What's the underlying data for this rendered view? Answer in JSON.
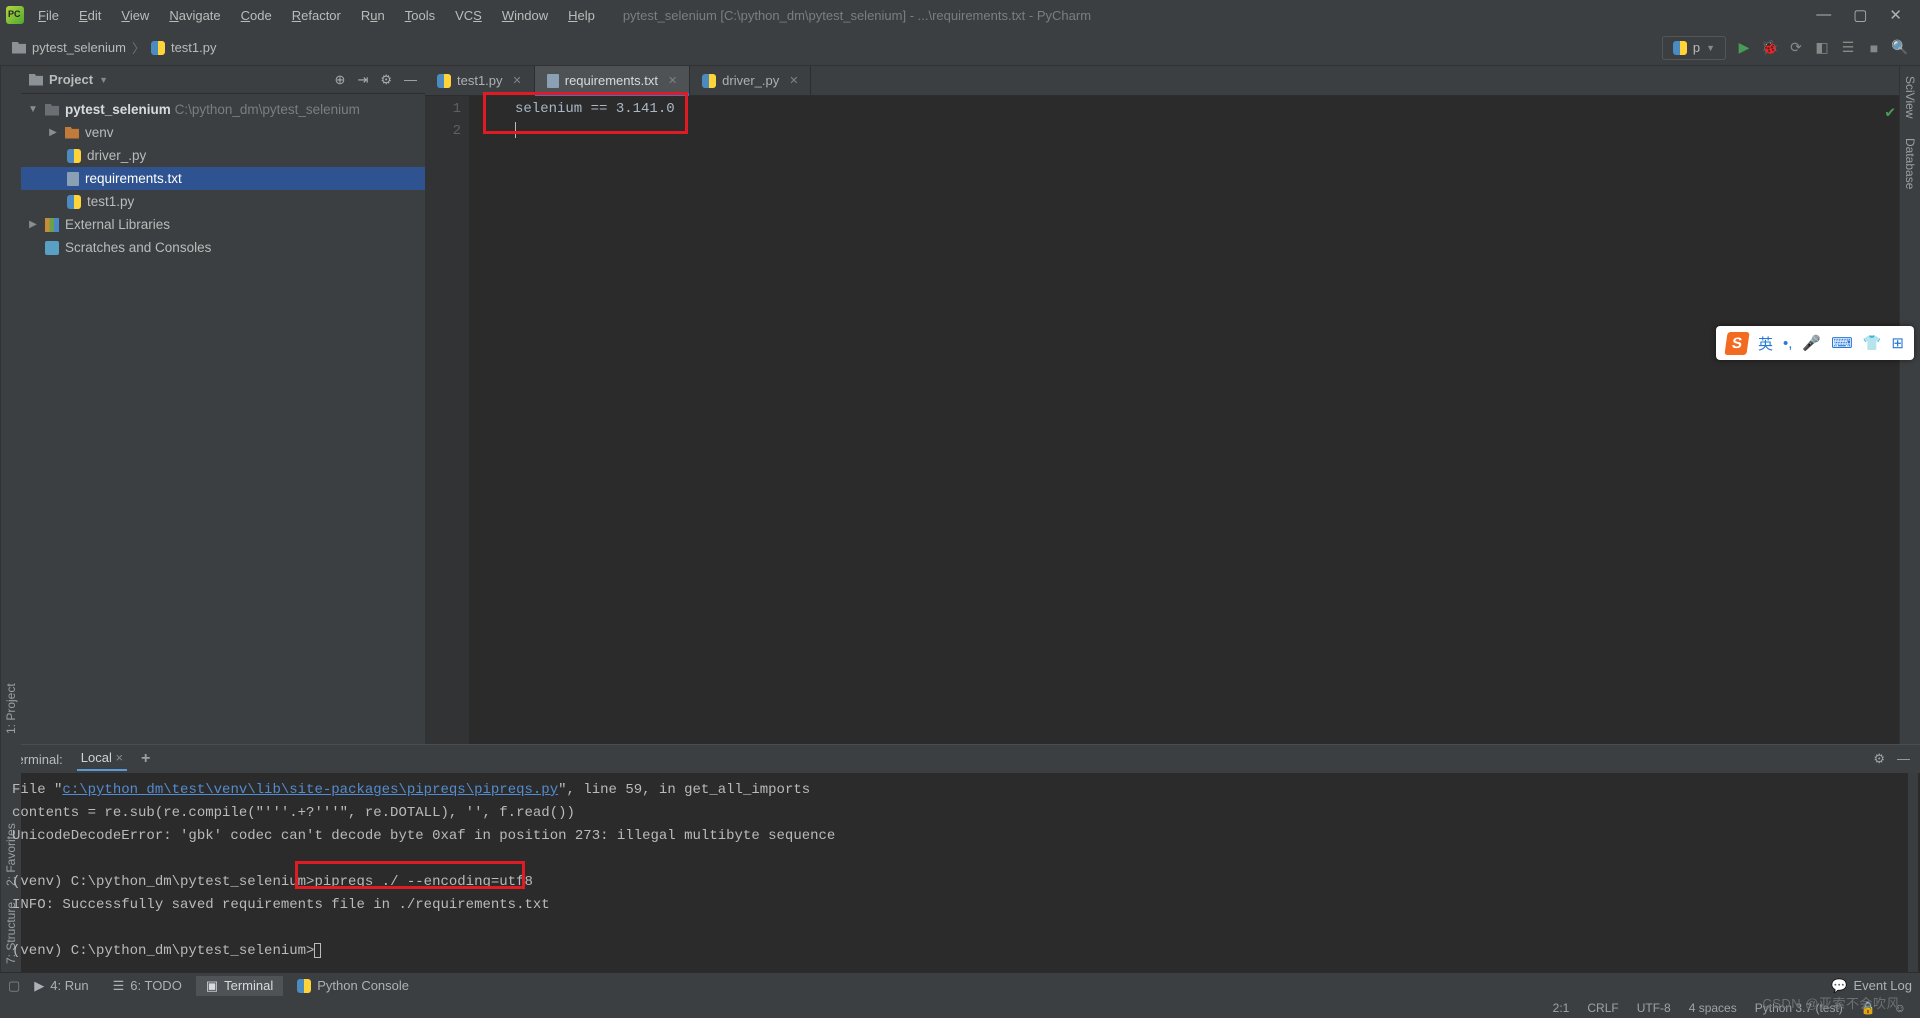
{
  "window": {
    "title": "pytest_selenium [C:\\python_dm\\pytest_selenium] - ...\\requirements.txt - PyCharm"
  },
  "menu": [
    "File",
    "Edit",
    "View",
    "Navigate",
    "Code",
    "Refactor",
    "Run",
    "Tools",
    "VCS",
    "Window",
    "Help"
  ],
  "breadcrumb": {
    "root": "pytest_selenium",
    "file": "test1.py"
  },
  "run_config": {
    "label": "p"
  },
  "left_sidebar": {
    "project": "1: Project"
  },
  "right_sidebar": {
    "sciview": "SciView",
    "database": "Database"
  },
  "left_sidebar2": {
    "structure": "7: Structure",
    "favorites": "2: Favorites"
  },
  "panel": {
    "title": "Project",
    "root": "pytest_selenium",
    "root_path": "C:\\python_dm\\pytest_selenium",
    "nodes": {
      "venv": "venv",
      "driver": "driver_.py",
      "req": "requirements.txt",
      "test1": "test1.py",
      "extlib": "External Libraries",
      "scratch": "Scratches and Consoles"
    }
  },
  "tabs": {
    "t1": "test1.py",
    "t2": "requirements.txt",
    "t3": "driver_.py"
  },
  "editor": {
    "ln1": "1",
    "ln2": "2",
    "line1": "selenium == 3.141.0"
  },
  "terminal": {
    "header": "Terminal:",
    "tab": "Local",
    "file_prefix": "  File \"",
    "file_link": "c:\\python_dm\\test\\venv\\lib\\site-packages\\pipreqs\\pipreqs.py",
    "file_suffix": "\", line 59, in get_all_imports",
    "l2": "    contents = re.sub(re.compile(\"'''.+?'''\", re.DOTALL), '', f.read())",
    "l3": "UnicodeDecodeError: 'gbk' codec can't decode byte 0xaf in position 273: illegal multibyte sequence",
    "prompt1_pre": "(venv) C:\\python_dm\\pytest_selenium>",
    "prompt1_cmd": "pipreqs ./ --encoding=utf8",
    "l5": "INFO: Successfully saved requirements file in ./requirements.txt",
    "prompt2": "(venv) C:\\python_dm\\pytest_selenium>"
  },
  "toolwins": {
    "run": "4: Run",
    "todo": "6: TODO",
    "terminal": "Terminal",
    "pyconsole": "Python Console",
    "eventlog": "Event Log"
  },
  "status": {
    "pos": "2:1",
    "eol": "CRLF",
    "enc": "UTF-8",
    "indent": "4 spaces",
    "python": "Python 3.7 (test)"
  },
  "ime": {
    "label": "英"
  },
  "watermark": "CSDN @亚索不会吹风"
}
